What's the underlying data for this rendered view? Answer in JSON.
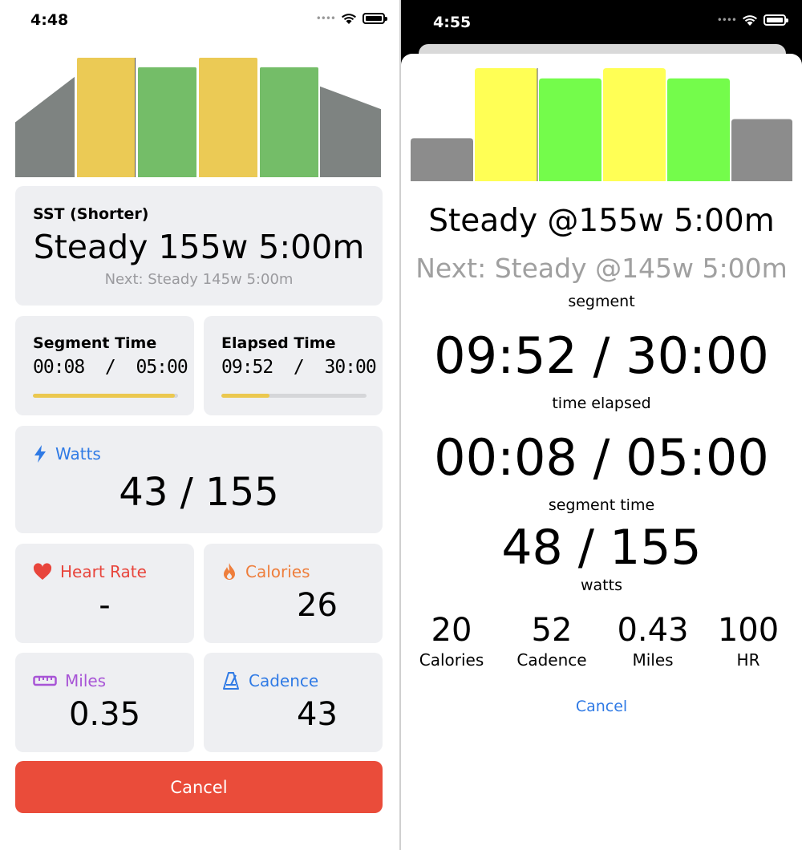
{
  "left": {
    "status_bar": {
      "time": "4:48",
      "dots": "••••"
    },
    "chart_data": {
      "type": "bar",
      "segments": [
        {
          "kind": "ramp-up",
          "color": "#7e8381",
          "from": 0.46,
          "to": 0.84
        },
        {
          "kind": "steady",
          "color": "#ebca55",
          "level": 1.0
        },
        {
          "kind": "steady",
          "color": "#74bd68",
          "level": 0.92
        },
        {
          "kind": "steady",
          "color": "#ebca55",
          "level": 1.0
        },
        {
          "kind": "steady",
          "color": "#74bd68",
          "level": 0.92
        },
        {
          "kind": "ramp-down",
          "color": "#7e8381",
          "from": 0.76,
          "to": 0.57
        }
      ],
      "progress_marker_segment": 1
    },
    "workout": {
      "name": "SST (Shorter)",
      "current": "Steady 155w 5:00m",
      "next": "Next: Steady 145w 5:00m"
    },
    "segment_time": {
      "label": "Segment Time",
      "value": "00:08  /  05:00",
      "progress": 0.98
    },
    "elapsed_time": {
      "label": "Elapsed Time",
      "value": "09:52  /  30:00",
      "progress": 0.33
    },
    "watts": {
      "label": "Watts",
      "value": "43 / 155",
      "icon": "bolt-icon"
    },
    "heart_rate": {
      "label": "Heart Rate",
      "value": "-",
      "icon": "heart-icon"
    },
    "calories": {
      "label": "Calories",
      "value": "26",
      "icon": "flame-icon"
    },
    "miles": {
      "label": "Miles",
      "value": "0.35",
      "icon": "ruler-icon"
    },
    "cadence": {
      "label": "Cadence",
      "value": "43",
      "icon": "metronome-icon"
    },
    "cancel_label": "Cancel",
    "colors": {
      "accent": "#2f7ae5",
      "danger": "#ea4c3a",
      "card": "#eeeff2"
    }
  },
  "right": {
    "status_bar": {
      "time": "4:55",
      "dots": "••••"
    },
    "chart_data": {
      "type": "bar",
      "segments": [
        {
          "color": "#8c8c8c",
          "level": 0.38
        },
        {
          "color": "#ffff55",
          "level": 1.0
        },
        {
          "color": "#74fc4b",
          "level": 0.91
        },
        {
          "color": "#ffff55",
          "level": 1.0
        },
        {
          "color": "#74fc4b",
          "level": 0.91
        },
        {
          "color": "#8c8c8c",
          "level": 0.55
        }
      ],
      "progress_marker_segment": 1
    },
    "current": "Steady @155w 5:00m",
    "next": "Next: Steady @145w 5:00m",
    "segment_caption": "segment",
    "elapsed_value": "09:52 / 30:00",
    "elapsed_caption": "time elapsed",
    "segment_time_value": "00:08 / 05:00",
    "segment_time_caption": "segment time",
    "watts_value": "48 / 155",
    "watts_caption": "watts",
    "stats": [
      {
        "value": "20",
        "label": "Calories"
      },
      {
        "value": "52",
        "label": "Cadence"
      },
      {
        "value": "0.43",
        "label": "Miles"
      },
      {
        "value": "100",
        "label": "HR"
      }
    ],
    "cancel_label": "Cancel"
  }
}
